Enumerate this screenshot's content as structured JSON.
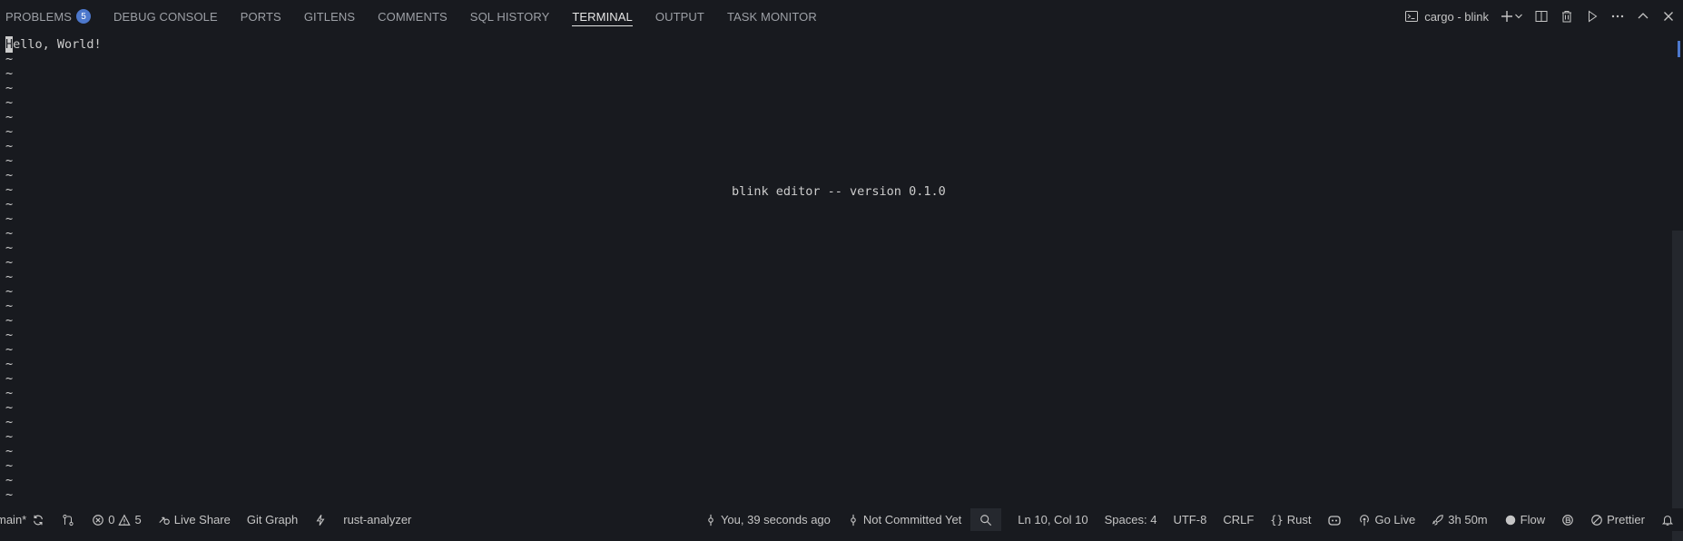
{
  "panel": {
    "tabs": [
      {
        "label": "PROBLEMS",
        "badge": "5"
      },
      {
        "label": "DEBUG CONSOLE"
      },
      {
        "label": "PORTS"
      },
      {
        "label": "GITLENS"
      },
      {
        "label": "COMMENTS"
      },
      {
        "label": "SQL HISTORY"
      },
      {
        "label": "TERMINAL",
        "active": true
      },
      {
        "label": "OUTPUT"
      },
      {
        "label": "TASK MONITOR"
      }
    ],
    "terminal_name": "cargo - blink",
    "icons": [
      "terminal-icon",
      "plus-icon",
      "chevron-down-icon",
      "split-icon",
      "trash-icon",
      "play-icon",
      "more-icon",
      "chevron-up-icon",
      "close-icon"
    ]
  },
  "terminal": {
    "first_line_cursor_char": "H",
    "first_line_rest": "ello, World!",
    "tilde": "~",
    "welcome": "blink editor -- version 0.1.0"
  },
  "status": {
    "branch": "main*",
    "errors": "0",
    "warnings": "5",
    "live_share": "Live Share",
    "git_graph": "Git Graph",
    "rust_analyzer": "rust-analyzer",
    "blame": "You, 39 seconds ago",
    "commit": "Not Committed Yet",
    "position": "Ln 10, Col 10",
    "spaces": "Spaces: 4",
    "encoding": "UTF-8",
    "eol": "CRLF",
    "language": "Rust",
    "go_live": "Go Live",
    "timer": "3h 50m",
    "flow": "Flow",
    "prettier": "Prettier"
  },
  "colors": {
    "background": "#181a1f",
    "accent": "#4d78cc",
    "text": "#cccccc"
  }
}
